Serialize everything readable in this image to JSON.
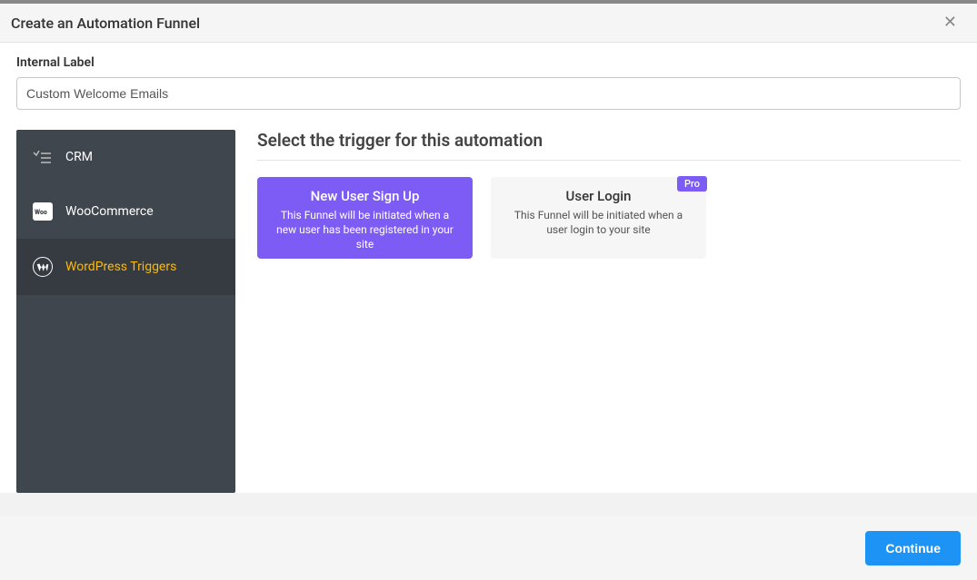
{
  "header": {
    "title": "Create an Automation Funnel"
  },
  "form": {
    "internal_label_title": "Internal Label",
    "internal_label_value": "Custom Welcome Emails"
  },
  "sidebar": {
    "items": [
      {
        "label": "CRM",
        "icon": "checklist-icon",
        "active": false
      },
      {
        "label": "WooCommerce",
        "icon": "woo-icon",
        "active": false
      },
      {
        "label": "WordPress Triggers",
        "icon": "wordpress-icon",
        "active": true
      }
    ]
  },
  "main": {
    "section_title": "Select the trigger for this automation",
    "cards": [
      {
        "title": "New User Sign Up",
        "desc": "This Funnel will be initiated when a new user has been registered in your site",
        "selected": true,
        "pro": false
      },
      {
        "title": "User Login",
        "desc": "This Funnel will be initiated when a user login to your site",
        "selected": false,
        "pro": true
      }
    ],
    "pro_label": "Pro"
  },
  "footer": {
    "continue_label": "Continue"
  }
}
